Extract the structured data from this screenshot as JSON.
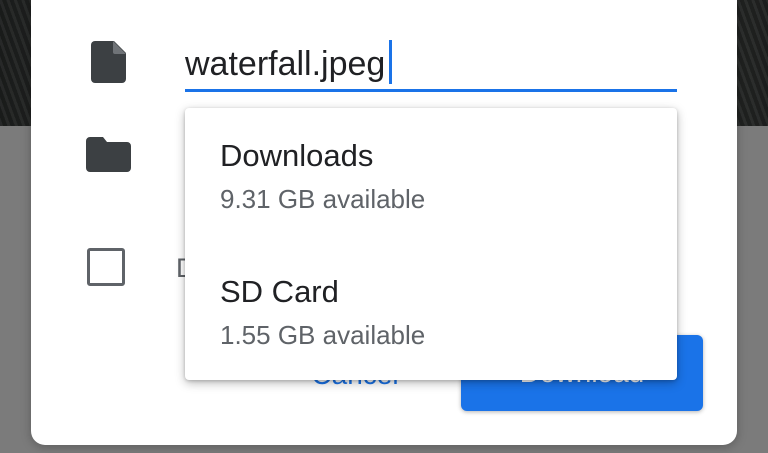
{
  "dialog": {
    "filename": "waterfall.jpeg",
    "checkbox_label": "Don't show again",
    "cancel_label": "Cancel",
    "download_label": "Download"
  },
  "location_dropdown": {
    "items": [
      {
        "label": "Downloads",
        "subtitle": "9.31 GB available"
      },
      {
        "label": "SD Card",
        "subtitle": "1.55 GB available"
      }
    ]
  },
  "colors": {
    "accent": "#1a73e8",
    "icon": "#3c4043",
    "text_primary": "#202124",
    "text_secondary": "#5f6368"
  },
  "icons": {
    "file": "file-icon",
    "folder": "folder-icon"
  }
}
